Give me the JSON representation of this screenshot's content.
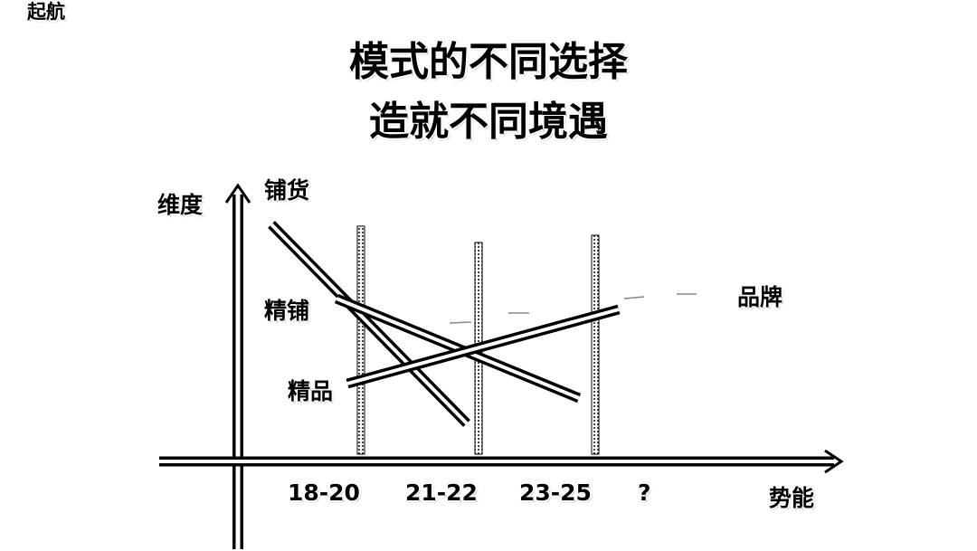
{
  "logo": {
    "text": "起航"
  },
  "title": {
    "line1": "模式的不同选择",
    "line2": "造就不同境遇"
  },
  "axes": {
    "y_label": "维度",
    "x_label": "势能"
  },
  "x_ticks": [
    "18-20",
    "21-22",
    "23-25",
    "?"
  ],
  "lines": {
    "pu_huo": "铺货",
    "jing_pu": "精铺",
    "jing_pin": "精品",
    "pin_pai": "品牌"
  }
}
